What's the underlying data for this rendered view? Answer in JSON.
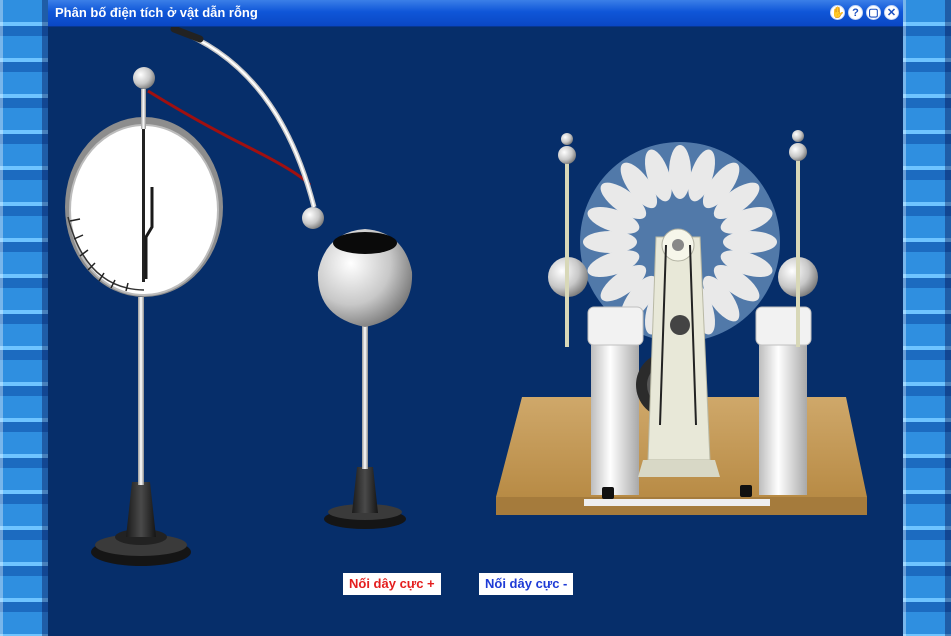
{
  "window": {
    "title": "Phân bố điện tích ở vật dẫn rỗng",
    "controls": [
      {
        "name": "hand-icon",
        "glyph": "✋"
      },
      {
        "name": "help-icon",
        "glyph": "?"
      },
      {
        "name": "restore-icon",
        "glyph": "▢"
      },
      {
        "name": "close-icon",
        "glyph": "✕"
      }
    ]
  },
  "buttons": {
    "positive_label": "Nối dây cực +",
    "negative_label": "Nối dây cực -"
  },
  "colors": {
    "titlebar": "#0f56d8",
    "stage": "#062e6a",
    "positive": "#e41e1e",
    "negative": "#1e3bd6"
  }
}
